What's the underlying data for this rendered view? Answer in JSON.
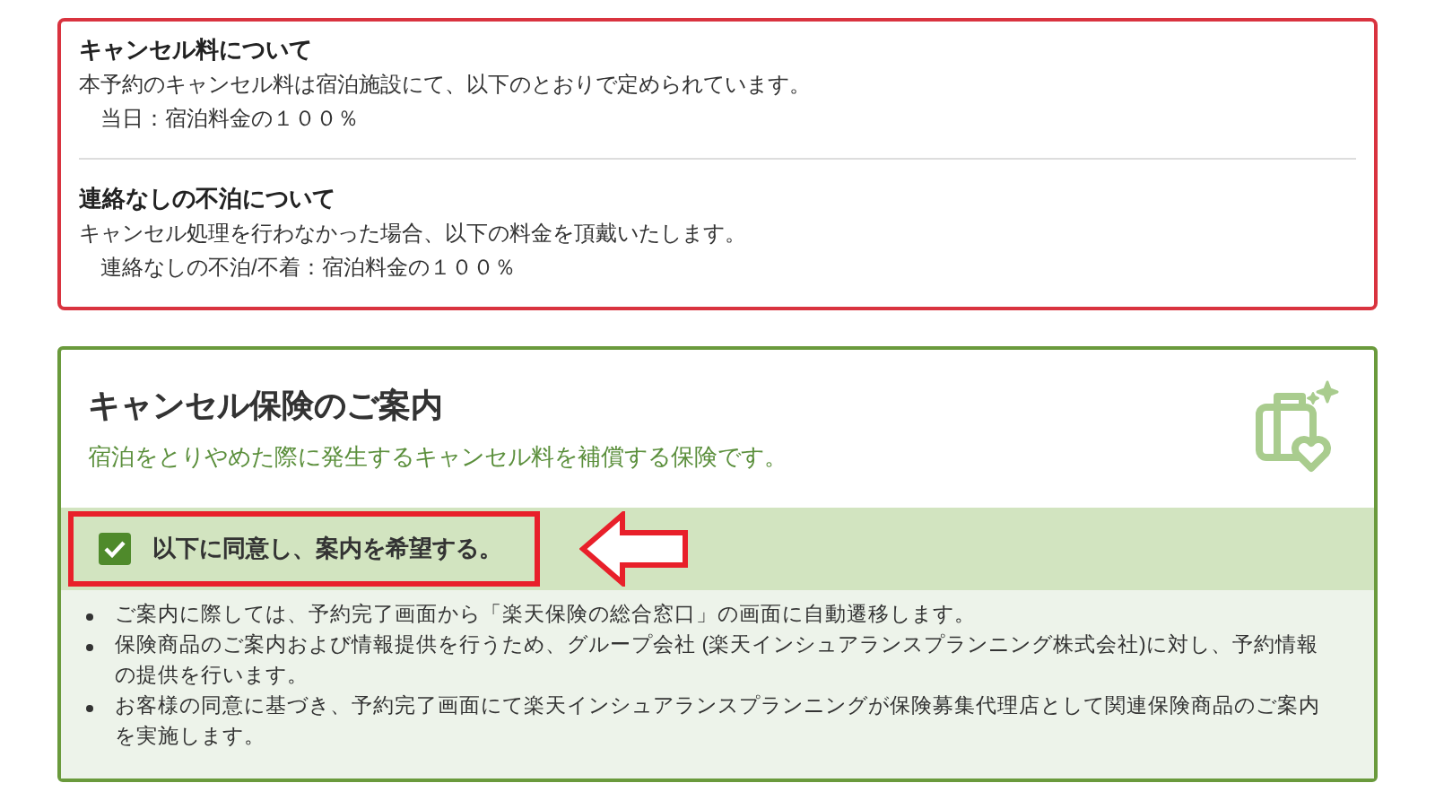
{
  "cancellation_policy": [
    {
      "title": "キャンセル料について",
      "description": "本予約のキャンセル料は宿泊施設にて、以下のとおりで定められています。",
      "detail": "当日：宿泊料金の１００％"
    },
    {
      "title": "連絡なしの不泊について",
      "description": "キャンセル処理を行わなかった場合、以下の料金を頂戴いたします。",
      "detail": "連絡なしの不泊/不着：宿泊料金の１００％"
    }
  ],
  "insurance": {
    "title": "キャンセル保険のご案内",
    "subtitle": "宿泊をとりやめた際に発生するキャンセル料を補償する保険です。",
    "consent": {
      "label": "以下に同意し、案内を希望する。",
      "checked": true
    },
    "notes": [
      "ご案内に際しては、予約完了画面から「楽天保険の総合窓口」の画面に自動遷移します。",
      "保険商品のご案内および情報提供を行うため、グループ会社 (楽天インシュアランスプランニング株式会社)に対し、予約情報の提供を行います。",
      "お客様の同意に基づき、予約完了画面にて楽天インシュアランスプランニングが保険募集代理店として関連保険商品のご案内を実施します。"
    ]
  }
}
